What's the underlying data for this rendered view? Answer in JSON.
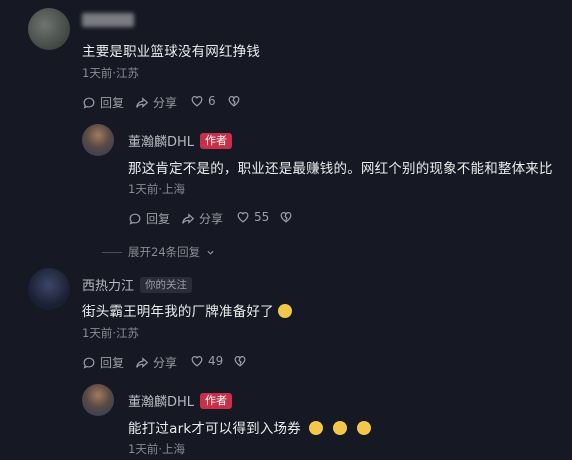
{
  "comments": [
    {
      "name": "",
      "text": "主要是职业篮球没有网红挣钱",
      "meta": "1天前·江苏",
      "reply": "回复",
      "share": "分享",
      "likes": "6",
      "reply_comment": {
        "name": "董瀚麟DHL",
        "badge": "作者",
        "text": "那这肯定不是的，职业还是最赚钱的。网红个别的现象不能和整体来比",
        "meta": "1天前·上海",
        "reply": "回复",
        "share": "分享",
        "likes": "55"
      },
      "expand": "展开24条回复"
    },
    {
      "name": "西热力江",
      "badge": "你的关注",
      "text": "街头霸王明年我的厂牌准备好了",
      "meta": "1天前·江苏",
      "reply": "回复",
      "share": "分享",
      "likes": "49",
      "reply_comment": {
        "name": "董瀚麟DHL",
        "badge": "作者",
        "text": "能打过ark才可以得到入场券",
        "meta": "1天前·上海"
      }
    }
  ],
  "icons": {
    "reply": "comment-icon",
    "share": "share-icon",
    "like": "heart-icon",
    "dislike": "broken-heart-icon",
    "expand": "chevron-down-icon"
  },
  "colors": {
    "background": "#161823",
    "author_badge": "#c8304a"
  }
}
